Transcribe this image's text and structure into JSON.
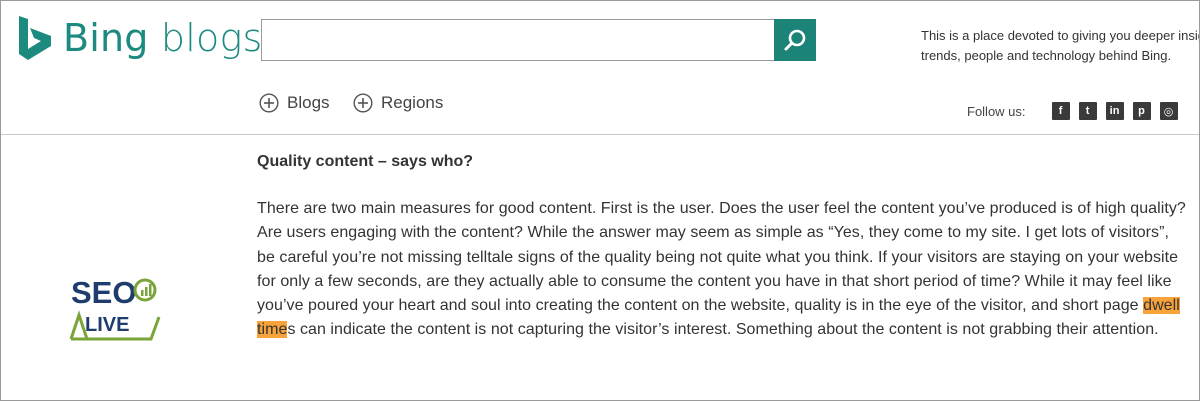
{
  "header": {
    "logo_brand": "Bing",
    "logo_suffix": " blogs",
    "search": {
      "value": "",
      "placeholder": ""
    },
    "tagline_line1": "This is a place devoted to giving you deeper insig",
    "tagline_line2": "trends, people and technology behind Bing."
  },
  "nav": {
    "items": [
      {
        "label": "Blogs",
        "icon": "plus-circle-icon"
      },
      {
        "label": "Regions",
        "icon": "plus-circle-icon"
      }
    ]
  },
  "follow": {
    "label": "Follow us:",
    "networks": [
      {
        "name": "facebook",
        "glyph": "f"
      },
      {
        "name": "twitter",
        "glyph": "t"
      },
      {
        "name": "linkedin",
        "glyph": "in"
      },
      {
        "name": "pinterest",
        "glyph": "p"
      },
      {
        "name": "instagram",
        "glyph": "◎"
      }
    ]
  },
  "sidebar_logo": {
    "line1": "SEO",
    "line2": "LIVE",
    "colors": {
      "navy": "#1f3c6e",
      "green": "#7aa43a"
    }
  },
  "article": {
    "title": "Quality content – says who?",
    "body_before": "There are two main measures for good content.  First is the user.  Does the user feel the content you’ve produced is of high quality?  Are users engaging with the content?  While the answer may seem as simple as “Yes, they come to my site.  I get lots of visitors”, be careful you’re not missing telltale signs of the quality being not quite what you think.  If your visitors are staying on your website for only a few seconds, are they actually able to consume the content you have in that short period of time?  While it may feel like you’ve poured your heart and soul into creating the content on the website, quality is in the eye of the visitor, and short page ",
    "highlight": "dwell time",
    "body_after": "s can indicate the content is not capturing the visitor’s interest.  Something about the content is not grabbing their attention.",
    "highlight_color": "#f7a23b"
  },
  "colors": {
    "brand": "#1d8a80",
    "search_button": "#1b8378"
  }
}
